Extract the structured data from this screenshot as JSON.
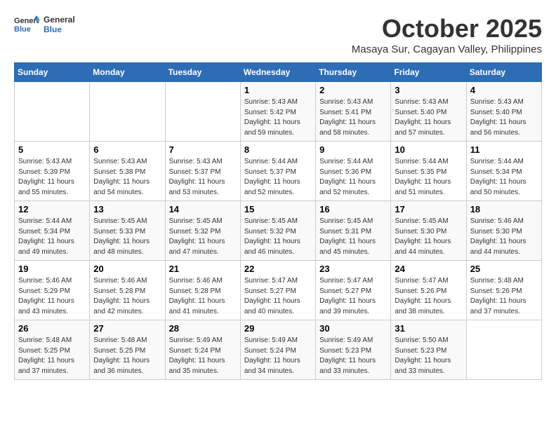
{
  "header": {
    "logo_line1": "General",
    "logo_line2": "Blue",
    "month": "October 2025",
    "subtitle": "Masaya Sur, Cagayan Valley, Philippines"
  },
  "days_of_week": [
    "Sunday",
    "Monday",
    "Tuesday",
    "Wednesday",
    "Thursday",
    "Friday",
    "Saturday"
  ],
  "weeks": [
    [
      {
        "day": "",
        "info": ""
      },
      {
        "day": "",
        "info": ""
      },
      {
        "day": "",
        "info": ""
      },
      {
        "day": "1",
        "info": "Sunrise: 5:43 AM\nSunset: 5:42 PM\nDaylight: 11 hours\nand 59 minutes."
      },
      {
        "day": "2",
        "info": "Sunrise: 5:43 AM\nSunset: 5:41 PM\nDaylight: 11 hours\nand 58 minutes."
      },
      {
        "day": "3",
        "info": "Sunrise: 5:43 AM\nSunset: 5:40 PM\nDaylight: 11 hours\nand 57 minutes."
      },
      {
        "day": "4",
        "info": "Sunrise: 5:43 AM\nSunset: 5:40 PM\nDaylight: 11 hours\nand 56 minutes."
      }
    ],
    [
      {
        "day": "5",
        "info": "Sunrise: 5:43 AM\nSunset: 5:39 PM\nDaylight: 11 hours\nand 55 minutes."
      },
      {
        "day": "6",
        "info": "Sunrise: 5:43 AM\nSunset: 5:38 PM\nDaylight: 11 hours\nand 54 minutes."
      },
      {
        "day": "7",
        "info": "Sunrise: 5:43 AM\nSunset: 5:37 PM\nDaylight: 11 hours\nand 53 minutes."
      },
      {
        "day": "8",
        "info": "Sunrise: 5:44 AM\nSunset: 5:37 PM\nDaylight: 11 hours\nand 52 minutes."
      },
      {
        "day": "9",
        "info": "Sunrise: 5:44 AM\nSunset: 5:36 PM\nDaylight: 11 hours\nand 52 minutes."
      },
      {
        "day": "10",
        "info": "Sunrise: 5:44 AM\nSunset: 5:35 PM\nDaylight: 11 hours\nand 51 minutes."
      },
      {
        "day": "11",
        "info": "Sunrise: 5:44 AM\nSunset: 5:34 PM\nDaylight: 11 hours\nand 50 minutes."
      }
    ],
    [
      {
        "day": "12",
        "info": "Sunrise: 5:44 AM\nSunset: 5:34 PM\nDaylight: 11 hours\nand 49 minutes."
      },
      {
        "day": "13",
        "info": "Sunrise: 5:45 AM\nSunset: 5:33 PM\nDaylight: 11 hours\nand 48 minutes."
      },
      {
        "day": "14",
        "info": "Sunrise: 5:45 AM\nSunset: 5:32 PM\nDaylight: 11 hours\nand 47 minutes."
      },
      {
        "day": "15",
        "info": "Sunrise: 5:45 AM\nSunset: 5:32 PM\nDaylight: 11 hours\nand 46 minutes."
      },
      {
        "day": "16",
        "info": "Sunrise: 5:45 AM\nSunset: 5:31 PM\nDaylight: 11 hours\nand 45 minutes."
      },
      {
        "day": "17",
        "info": "Sunrise: 5:45 AM\nSunset: 5:30 PM\nDaylight: 11 hours\nand 44 minutes."
      },
      {
        "day": "18",
        "info": "Sunrise: 5:46 AM\nSunset: 5:30 PM\nDaylight: 11 hours\nand 44 minutes."
      }
    ],
    [
      {
        "day": "19",
        "info": "Sunrise: 5:46 AM\nSunset: 5:29 PM\nDaylight: 11 hours\nand 43 minutes."
      },
      {
        "day": "20",
        "info": "Sunrise: 5:46 AM\nSunset: 5:28 PM\nDaylight: 11 hours\nand 42 minutes."
      },
      {
        "day": "21",
        "info": "Sunrise: 5:46 AM\nSunset: 5:28 PM\nDaylight: 11 hours\nand 41 minutes."
      },
      {
        "day": "22",
        "info": "Sunrise: 5:47 AM\nSunset: 5:27 PM\nDaylight: 11 hours\nand 40 minutes."
      },
      {
        "day": "23",
        "info": "Sunrise: 5:47 AM\nSunset: 5:27 PM\nDaylight: 11 hours\nand 39 minutes."
      },
      {
        "day": "24",
        "info": "Sunrise: 5:47 AM\nSunset: 5:26 PM\nDaylight: 11 hours\nand 38 minutes."
      },
      {
        "day": "25",
        "info": "Sunrise: 5:48 AM\nSunset: 5:26 PM\nDaylight: 11 hours\nand 37 minutes."
      }
    ],
    [
      {
        "day": "26",
        "info": "Sunrise: 5:48 AM\nSunset: 5:25 PM\nDaylight: 11 hours\nand 37 minutes."
      },
      {
        "day": "27",
        "info": "Sunrise: 5:48 AM\nSunset: 5:25 PM\nDaylight: 11 hours\nand 36 minutes."
      },
      {
        "day": "28",
        "info": "Sunrise: 5:49 AM\nSunset: 5:24 PM\nDaylight: 11 hours\nand 35 minutes."
      },
      {
        "day": "29",
        "info": "Sunrise: 5:49 AM\nSunset: 5:24 PM\nDaylight: 11 hours\nand 34 minutes."
      },
      {
        "day": "30",
        "info": "Sunrise: 5:49 AM\nSunset: 5:23 PM\nDaylight: 11 hours\nand 33 minutes."
      },
      {
        "day": "31",
        "info": "Sunrise: 5:50 AM\nSunset: 5:23 PM\nDaylight: 11 hours\nand 33 minutes."
      },
      {
        "day": "",
        "info": ""
      }
    ]
  ]
}
